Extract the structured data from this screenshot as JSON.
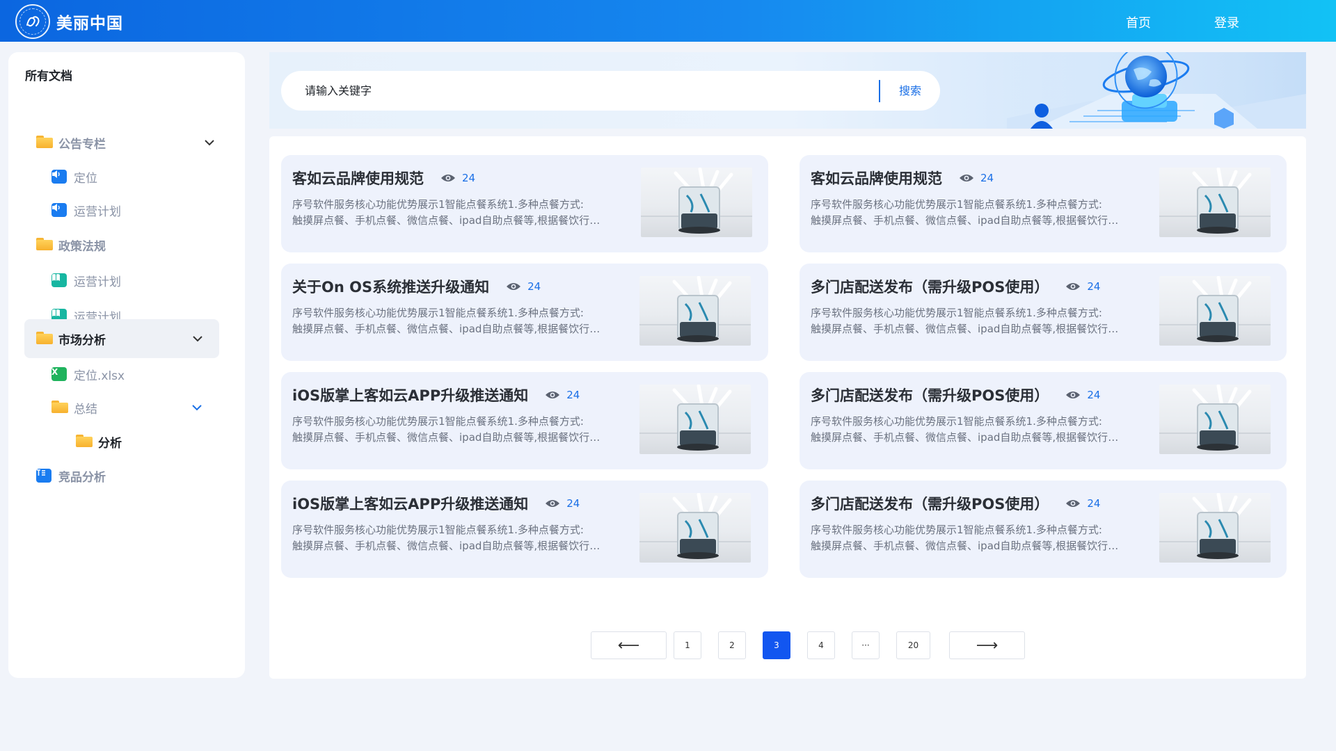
{
  "header": {
    "app_title": "美丽中国",
    "nav": {
      "home": "首页",
      "login": "登录"
    }
  },
  "sidebar": {
    "title": "所有文档",
    "items": [
      {
        "label": "公告专栏",
        "icon": "folder-icon",
        "level": 1,
        "expanded": true
      },
      {
        "label": "定位",
        "icon": "speaker-icon",
        "level": 2
      },
      {
        "label": "运营计划",
        "icon": "speaker-icon",
        "level": 2
      },
      {
        "label": "政策法规",
        "icon": "folder-icon",
        "level": 1
      },
      {
        "label": "运营计划",
        "icon": "book-icon",
        "level": 2
      },
      {
        "label": "运营计划",
        "icon": "book-icon",
        "level": 2
      },
      {
        "label": "市场分析",
        "icon": "folder-icon",
        "level": 1,
        "expanded": true,
        "active": true
      },
      {
        "label": "定位.xlsx",
        "icon": "excel-icon",
        "level": 2
      },
      {
        "label": "总结",
        "icon": "folder-icon",
        "level": 2,
        "expanded": true
      },
      {
        "label": "分析",
        "icon": "folder-icon",
        "level": 3
      },
      {
        "label": "竞品分析",
        "icon": "doc-icon",
        "level": 1
      }
    ]
  },
  "search": {
    "placeholder": "请输入关键字",
    "button": "搜索"
  },
  "cards": [
    {
      "title": "客如云品牌使用规范",
      "views": "24",
      "desc1": "序号软件服务核心功能优势展示1智能点餐系统1.多种点餐方式:",
      "desc2": "触摸屏点餐、手机点餐、微信点餐、ipad自助点餐等,根据餐饮行业的实际需求"
    },
    {
      "title": "客如云品牌使用规范",
      "views": "24",
      "desc1": "序号软件服务核心功能优势展示1智能点餐系统1.多种点餐方式:",
      "desc2": "触摸屏点餐、手机点餐、微信点餐、ipad自助点餐等,根据餐饮行业的实际需求"
    },
    {
      "title": "关于On OS系统推送升级通知",
      "views": "24",
      "desc1": "序号软件服务核心功能优势展示1智能点餐系统1.多种点餐方式:",
      "desc2": "触摸屏点餐、手机点餐、微信点餐、ipad自助点餐等,根据餐饮行业的实际需求"
    },
    {
      "title": "多门店配送发布（需升级POS使用）",
      "views": "24",
      "desc1": "序号软件服务核心功能优势展示1智能点餐系统1.多种点餐方式:",
      "desc2": "触摸屏点餐、手机点餐、微信点餐、ipad自助点餐等,根据餐饮行业的实际需求"
    },
    {
      "title": "iOS版掌上客如云APP升级推送通知",
      "views": "24",
      "desc1": "序号软件服务核心功能优势展示1智能点餐系统1.多种点餐方式:",
      "desc2": "触摸屏点餐、手机点餐、微信点餐、ipad自助点餐等,根据餐饮行业的实际需求"
    },
    {
      "title": "多门店配送发布（需升级POS使用）",
      "views": "24",
      "desc1": "序号软件服务核心功能优势展示1智能点餐系统1.多种点餐方式:",
      "desc2": "触摸屏点餐、手机点餐、微信点餐、ipad自助点餐等,根据餐饮行业的实际需求"
    },
    {
      "title": "iOS版掌上客如云APP升级推送通知",
      "views": "24",
      "desc1": "序号软件服务核心功能优势展示1智能点餐系统1.多种点餐方式:",
      "desc2": "触摸屏点餐、手机点餐、微信点餐、ipad自助点餐等,根据餐饮行业的实际需求"
    },
    {
      "title": "多门店配送发布（需升级POS使用）",
      "views": "24",
      "desc1": "序号软件服务核心功能优势展示1智能点餐系统1.多种点餐方式:",
      "desc2": "触摸屏点餐、手机点餐、微信点餐、ipad自助点餐等,根据餐饮行业的实际需求"
    }
  ],
  "pagination": {
    "prev": "⟵",
    "pages": [
      "1",
      "2",
      "3",
      "4",
      "···",
      "20"
    ],
    "current": "3",
    "next": "⟶"
  },
  "colors": {
    "primary": "#1a6fe6",
    "active_page": "#1256f0",
    "card_bg": "#eef2fc",
    "folder": "#f7b12e"
  }
}
